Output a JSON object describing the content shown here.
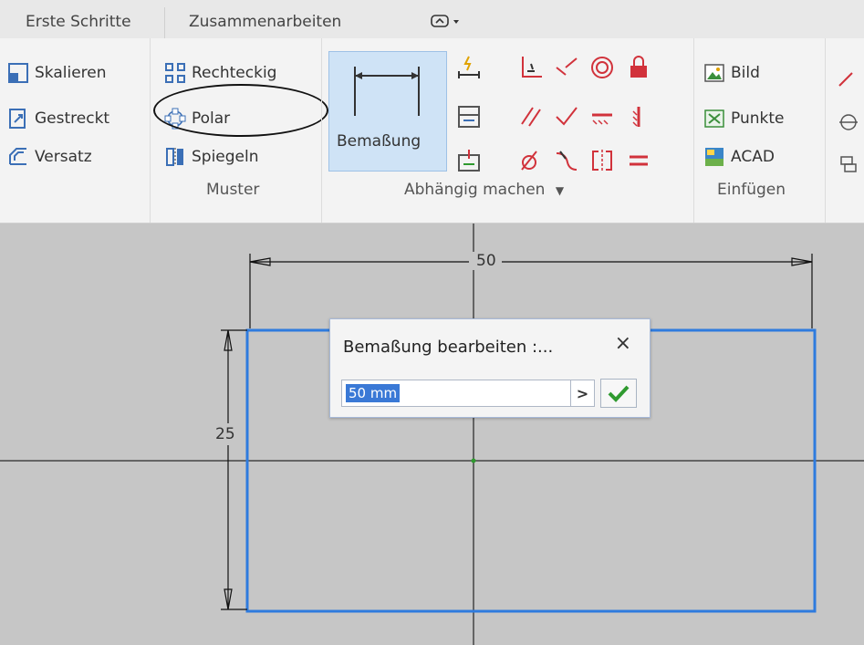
{
  "tabs": {
    "erste_schritte": "Erste Schritte",
    "zusammenarbeiten": "Zusammenarbeiten"
  },
  "ribbon": {
    "modify": {
      "skalieren": "Skalieren",
      "gestreckt": "Gestreckt",
      "versatz": "Versatz"
    },
    "muster": {
      "label": "Muster",
      "rechteckig": "Rechteckig",
      "polar": "Polar",
      "spiegeln": "Spiegeln"
    },
    "abhaengig": {
      "label": "Abhängig machen",
      "bemassung": "Bemaßung"
    },
    "einfuegen": {
      "label": "Einfügen",
      "bild": "Bild",
      "punkte": "Punkte",
      "acad": "ACAD"
    }
  },
  "canvas": {
    "dim_horizontal": "50",
    "dim_vertical": "25"
  },
  "dialog": {
    "title": "Bemaßung bearbeiten :...",
    "close": "×",
    "value": "50 mm",
    "arrow": ">"
  },
  "colors": {
    "selection_blue": "#2e7bde",
    "constraint_red": "#d1323b",
    "accent_green": "#2f9a2f"
  }
}
